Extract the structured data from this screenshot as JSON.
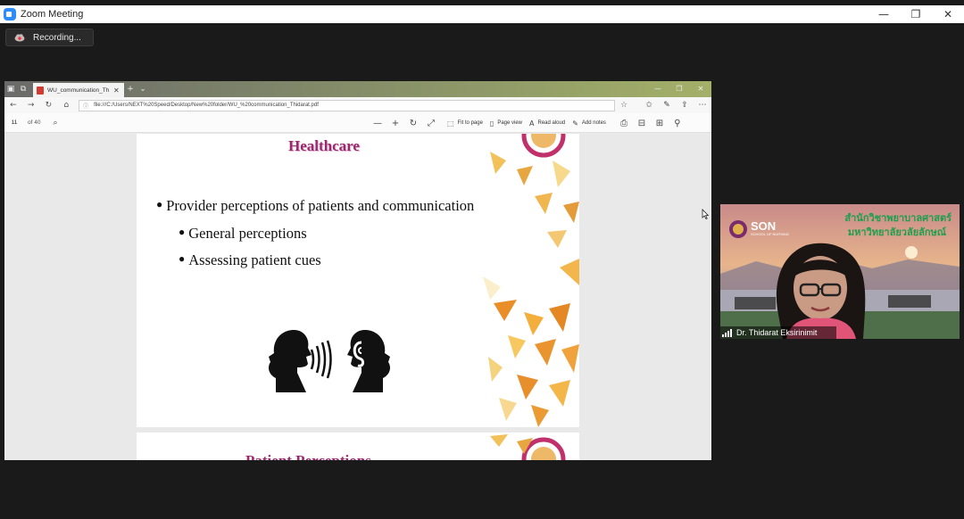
{
  "zoom": {
    "window_title": "Zoom Meeting",
    "controls": {
      "minimize": "—",
      "restore": "❐",
      "close": "✕"
    },
    "recording_label": "Recording..."
  },
  "browser": {
    "tab_title": "WU_communication_Th",
    "new_tab": "+",
    "tab_list": "⌄",
    "url": "file:///C:/Users/NEXT%20Speed/Desktop/New%20folder/WU_%20communication_Thidarat.pdf",
    "window_controls": {
      "minimize": "—",
      "restore": "❐",
      "close": "✕"
    }
  },
  "pdf_toolbar": {
    "page_number": "11",
    "page_total": "of 40",
    "zoom_out": "—",
    "zoom_in": "+",
    "fit_to_page": "Fit to page",
    "page_view": "Page view",
    "read_aloud": "Read aloud",
    "add_notes": "Add notes"
  },
  "slide": {
    "title": "Healthcare",
    "bullets": [
      "Provider perceptions of patients and communication",
      "General perceptions",
      "Assessing patient cues"
    ],
    "next_slide_title": "Patient Perceptions"
  },
  "video": {
    "banner_line_1": "สำนักวิชาพยาบาลศาสตร์",
    "banner_line_2": "มหาวิทยาลัยวลัยลักษณ์",
    "logo_text": "SON",
    "logo_sub": "SCHOOL OF NURSING",
    "participant_name": "Dr. Thidarat Eksirinimit"
  },
  "colors": {
    "slide_title": "#9a2a6e",
    "zoom_blue": "#2d8cff",
    "banner_green": "#1e9e4f"
  }
}
